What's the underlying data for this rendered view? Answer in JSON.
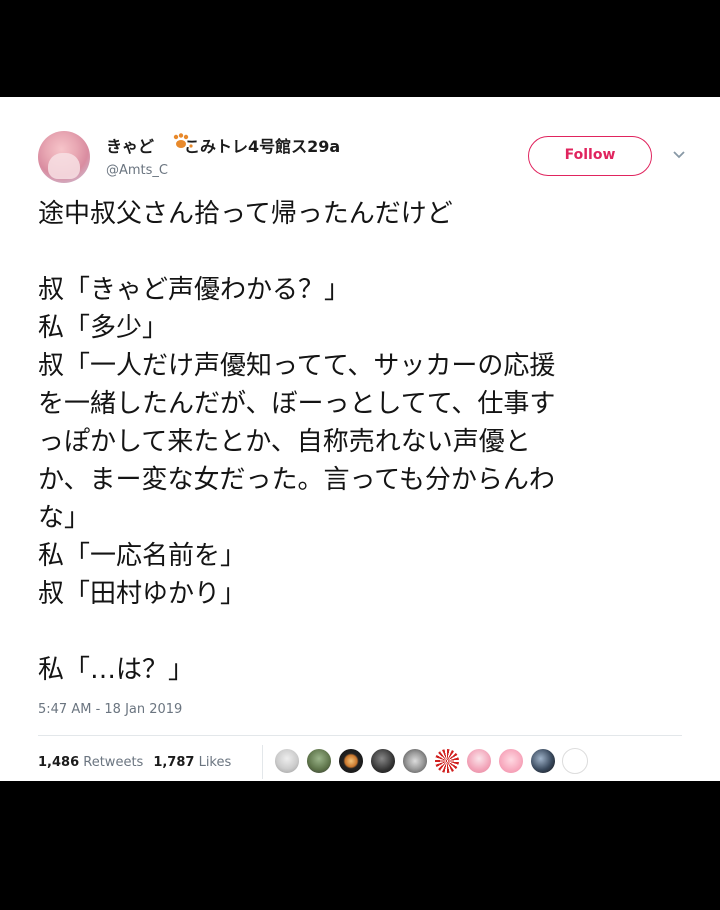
{
  "user": {
    "display_name": "きゃど",
    "display_name_suffix": "こみトレ4号館ス29a",
    "username": "@Amts_C"
  },
  "follow_label": "Follow",
  "tweet_lines": [
    "途中叔父さん拾って帰ったんだけど",
    "",
    "叔「きゃど声優わかる？」",
    "私「多少」",
    "叔「一人だけ声優知ってて、サッカーの応援",
    "を一緒したんだが、ぼーっとしてて、仕事す",
    "っぽかして来たとか、自称売れない声優と",
    "か、まー変な女だった。言っても分からんわ",
    "な」",
    "私「一応名前を」",
    "叔「田村ゆかり」",
    "",
    "私「…は？」"
  ],
  "timestamp": "5:47 AM - 18 Jan 2019",
  "stats": {
    "retweets_count": "1,486",
    "retweets_label": "Retweets",
    "likes_count": "1,787",
    "likes_label": "Likes"
  },
  "likers": [
    "cat-avatar",
    "girl-avatar",
    "cake-avatar",
    "moon-avatar",
    "face-avatar",
    "flag-avatar",
    "pink-girl-avatar",
    "pig-avatar",
    "car-avatar",
    "sketch-avatar"
  ],
  "colors": {
    "accent": "#e0245e",
    "text": "#141414",
    "muted": "#6b7580"
  }
}
